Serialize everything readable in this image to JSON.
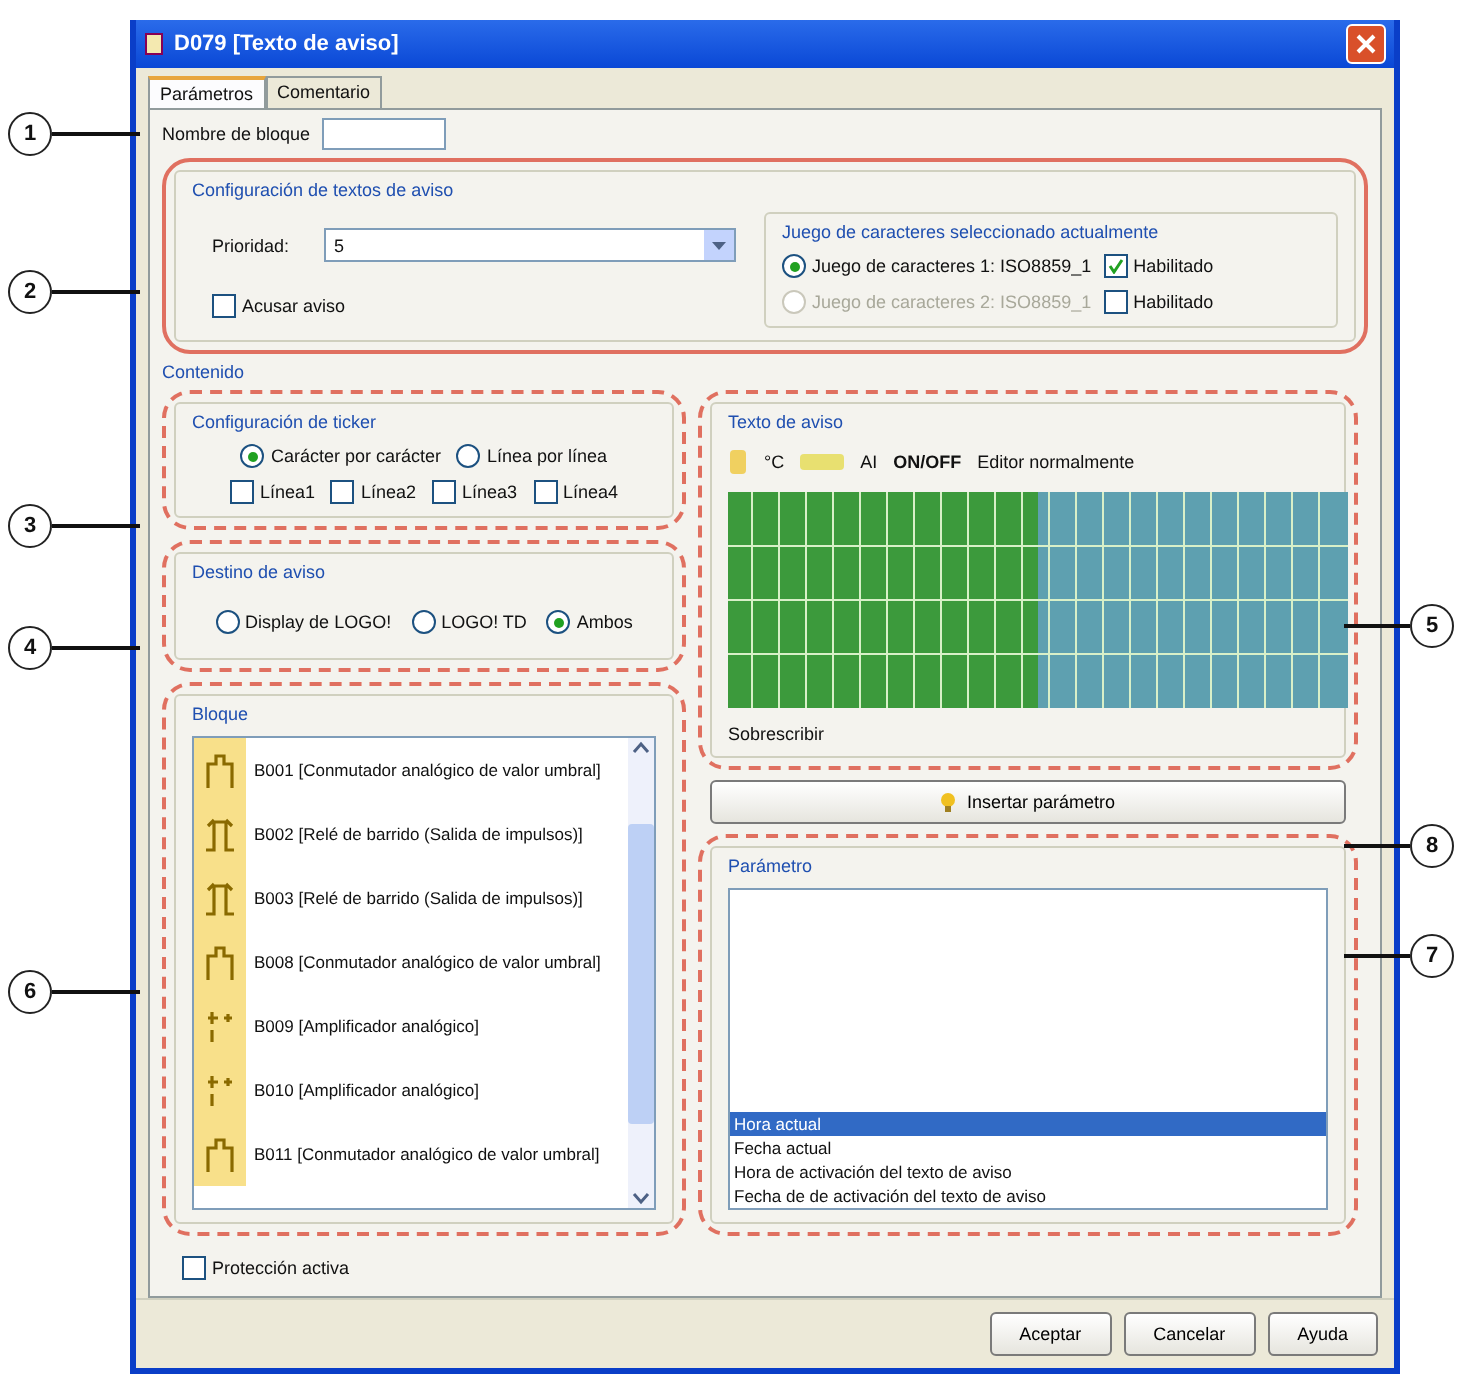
{
  "window": {
    "title": "D079 [Texto de aviso]"
  },
  "tabs": [
    {
      "label": "Parámetros",
      "selected": true
    },
    {
      "label": "Comentario",
      "selected": false
    }
  ],
  "block_name": {
    "label": "Nombre de bloque"
  },
  "message_config": {
    "title": "Configuración de textos de aviso",
    "priority_label": "Prioridad:",
    "priority_value": "5",
    "acknowledge": {
      "label": "Acusar aviso",
      "checked": false
    },
    "charset_group": {
      "title": "Juego de caracteres seleccionado actualmente",
      "options": [
        {
          "label": "Juego de caracteres 1: ISO8859_1",
          "selected": true,
          "disabled": false,
          "enabled_label": "Habilitado",
          "checked": true
        },
        {
          "label": "Juego de caracteres 2: ISO8859_1",
          "selected": false,
          "disabled": true,
          "enabled_label": "Habilitado",
          "checked": false
        }
      ]
    }
  },
  "content_label": "Contenido",
  "ticker": {
    "title": "Configuración de ticker",
    "modes": [
      {
        "label": "Carácter por carácter",
        "selected": true
      },
      {
        "label": "Línea por línea",
        "selected": false
      }
    ],
    "lines": [
      {
        "label": "Línea1",
        "checked": false
      },
      {
        "label": "Línea2",
        "checked": false
      },
      {
        "label": "Línea3",
        "checked": false
      },
      {
        "label": "Línea4",
        "checked": false
      }
    ]
  },
  "destination": {
    "title": "Destino de aviso",
    "options": [
      {
        "label": "Display de LOGO!",
        "selected": false
      },
      {
        "label": "LOGO! TD",
        "selected": false
      },
      {
        "label": "Ambos",
        "selected": true
      }
    ]
  },
  "blocks": {
    "title": "Bloque",
    "items": [
      {
        "kind": "threshold",
        "label": "B001 [Conmutador analógico de valor umbral]"
      },
      {
        "kind": "pulse",
        "label": "B002 [Relé de barrido (Salida de impulsos)]"
      },
      {
        "kind": "pulse",
        "label": "B003 [Relé de barrido (Salida de impulsos)]"
      },
      {
        "kind": "threshold",
        "label": "B008 [Conmutador analógico de valor umbral]"
      },
      {
        "kind": "amplifier",
        "label": "B009 [Amplificador analógico]"
      },
      {
        "kind": "amplifier",
        "label": "B010 [Amplificador analógico]"
      },
      {
        "kind": "threshold",
        "label": "B011 [Conmutador analógico de valor umbral]"
      }
    ]
  },
  "message_text": {
    "title": "Texto de aviso",
    "toolbar": [
      "°C",
      "AI",
      "ON/OFF",
      "Editor normalmente"
    ],
    "footer": "Sobrescribir"
  },
  "insert_button": "Insertar parámetro",
  "parameter": {
    "title": "Parámetro",
    "items": [
      {
        "label": "Hora actual",
        "selected": true
      },
      {
        "label": "Fecha actual",
        "selected": false
      },
      {
        "label": "Hora de activación del texto de aviso",
        "selected": false
      },
      {
        "label": "Fecha de de activación del texto de aviso",
        "selected": false
      }
    ]
  },
  "protection": {
    "label": "Protección activa",
    "checked": false
  },
  "buttons": [
    "Aceptar",
    "Cancelar",
    "Ayuda"
  ],
  "callouts": [
    "1",
    "2",
    "3",
    "5",
    "4",
    "8",
    "7",
    "6"
  ]
}
